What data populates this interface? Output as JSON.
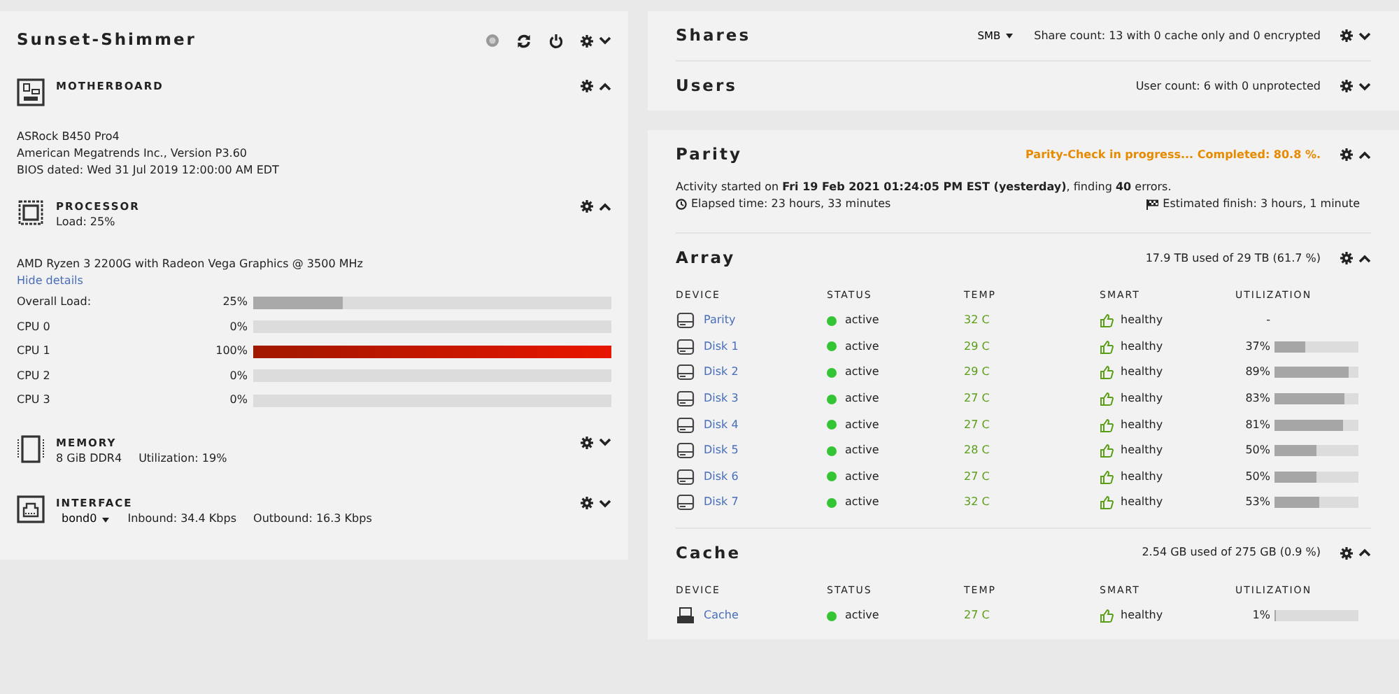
{
  "server": {
    "title": "Sunset-Shimmer",
    "expanded": false
  },
  "system": [
    {
      "kind": "motherboard",
      "title": "MOTHERBOARD",
      "expanded": true,
      "lines": [
        "ASRock B450 Pro4",
        "American Megatrends Inc., Version P3.60",
        "BIOS dated: Wed 31 Jul 2019 12:00:00 AM EDT"
      ]
    },
    {
      "kind": "processor",
      "title": "PROCESSOR",
      "expanded": true,
      "subtitle": "Load: 25%",
      "model": "AMD Ryzen 3 2200G with Radeon Vega Graphics @ 3500 MHz",
      "details_link": "Hide details",
      "loads": [
        {
          "label": "Overall Load:",
          "reading": "25%",
          "level": 0.25
        },
        {
          "label": "CPU 0",
          "reading": "0%",
          "level": 0
        },
        {
          "label": "CPU 1",
          "reading": "100%",
          "level": 1
        },
        {
          "label": "CPU 2",
          "reading": "0%",
          "level": 0
        },
        {
          "label": "CPU 3",
          "reading": "0%",
          "level": 0
        }
      ]
    },
    {
      "kind": "memory",
      "title": "MEMORY",
      "expanded": false,
      "info": [
        "8 GiB DDR4",
        "Utilization: 19%"
      ]
    },
    {
      "kind": "interface",
      "title": "INTERFACE",
      "expanded": false,
      "select": "bond0",
      "info": [
        "Inbound: 34.4 Kbps",
        "Outbound: 16.3 Kbps"
      ]
    }
  ],
  "shares": {
    "title": "Shares",
    "protocol": "SMB",
    "summary": "Share count: 13 with 0 cache only and 0 encrypted",
    "expanded": false
  },
  "users": {
    "title": "Users",
    "summary": "User count: 6 with 0 unprotected",
    "expanded": false
  },
  "parity": {
    "title": "Parity",
    "status": "Parity-Check in progress... Completed: 80.8 %.",
    "expanded": true,
    "activity": "Activity started on **Fri 19 Feb 2021 01:24:05 PM EST (yesterday)**, finding **40** errors.",
    "elapsed": "Elapsed time: 23 hours, 33 minutes",
    "finish": "Estimated finish: 3 hours, 1 minute"
  },
  "pools": [
    {
      "title": "Array",
      "summary": "17.9 TB used of 29 TB (61.7 %)",
      "expanded": true,
      "columns": [
        "DEVICE",
        "STATUS",
        "TEMP",
        "SMART",
        "UTILIZATION"
      ],
      "devices": [
        {
          "kind": "hdd",
          "name": "Parity",
          "status": "active",
          "temp": "32 C",
          "smart": "healthy",
          "utilization": "-"
        },
        {
          "kind": "hdd",
          "name": "Disk 1",
          "status": "active",
          "temp": "29 C",
          "smart": "healthy",
          "utilization": "37%",
          "level": 0.37
        },
        {
          "kind": "hdd",
          "name": "Disk 2",
          "status": "active",
          "temp": "29 C",
          "smart": "healthy",
          "utilization": "89%",
          "level": 0.89
        },
        {
          "kind": "hdd",
          "name": "Disk 3",
          "status": "active",
          "temp": "27 C",
          "smart": "healthy",
          "utilization": "83%",
          "level": 0.83
        },
        {
          "kind": "hdd",
          "name": "Disk 4",
          "status": "active",
          "temp": "27 C",
          "smart": "healthy",
          "utilization": "81%",
          "level": 0.81
        },
        {
          "kind": "hdd",
          "name": "Disk 5",
          "status": "active",
          "temp": "28 C",
          "smart": "healthy",
          "utilization": "50%",
          "level": 0.5
        },
        {
          "kind": "hdd",
          "name": "Disk 6",
          "status": "active",
          "temp": "27 C",
          "smart": "healthy",
          "utilization": "50%",
          "level": 0.5
        },
        {
          "kind": "hdd",
          "name": "Disk 7",
          "status": "active",
          "temp": "32 C",
          "smart": "healthy",
          "utilization": "53%",
          "level": 0.53
        }
      ]
    },
    {
      "title": "Cache",
      "summary": "2.54 GB used of 275 GB (0.9 %)",
      "expanded": true,
      "columns": [
        "DEVICE",
        "STATUS",
        "TEMP",
        "SMART",
        "UTILIZATION"
      ],
      "devices": [
        {
          "kind": "ssd",
          "name": "Cache",
          "status": "active",
          "temp": "27 C",
          "smart": "healthy",
          "utilization": "1%",
          "level": 0.01
        }
      ]
    }
  ]
}
